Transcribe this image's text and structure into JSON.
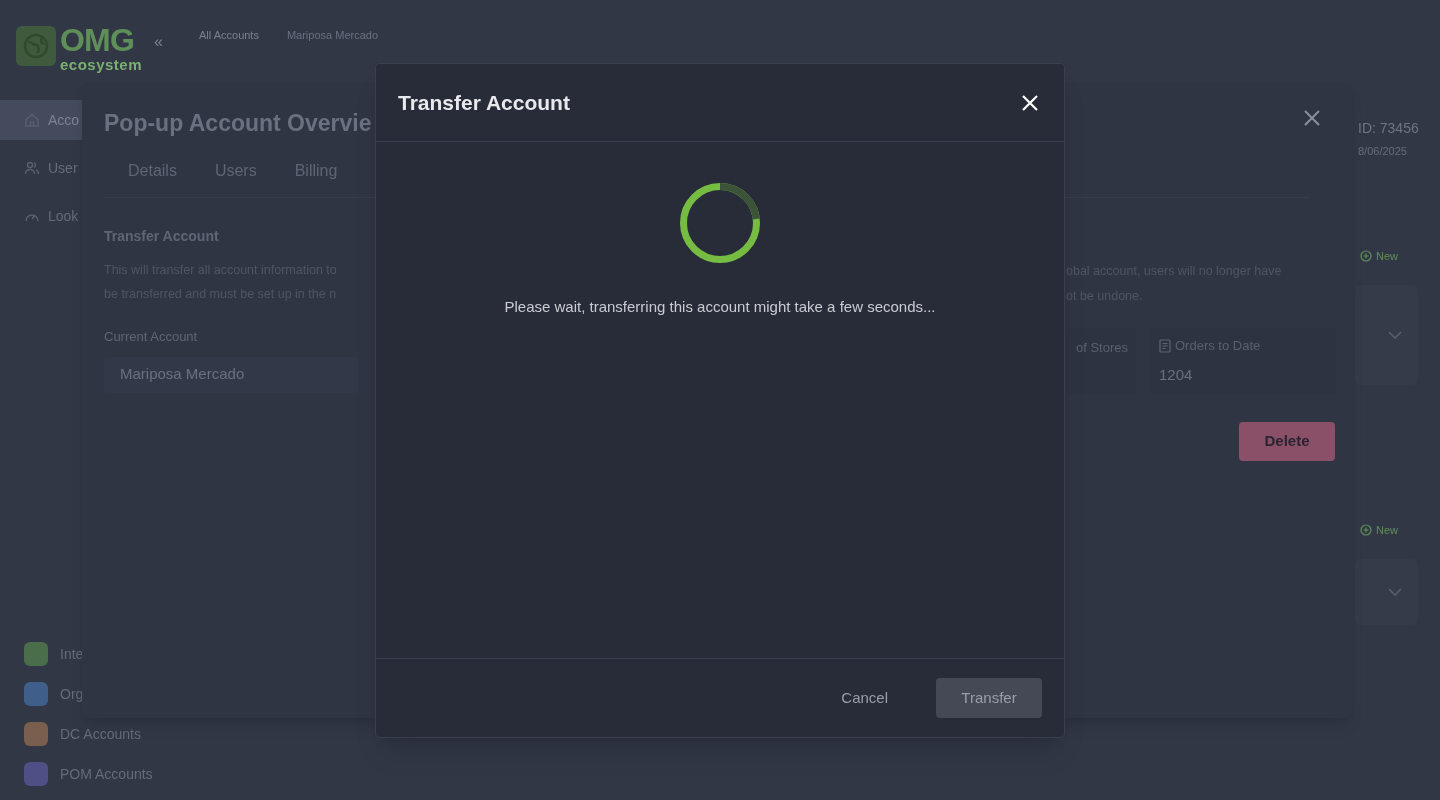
{
  "app": {
    "logo": {
      "title": "OMG",
      "subtitle": "ecosystem"
    },
    "collapse_icon": "«",
    "breadcrumbs": [
      "All Accounts",
      "Mariposa Mercado"
    ],
    "nav": [
      {
        "label": "Acco",
        "selected": true
      },
      {
        "label": "User",
        "selected": false
      },
      {
        "label": "Look",
        "selected": false
      }
    ],
    "apps": [
      {
        "label": "Inte",
        "color": "#4b6e4a"
      },
      {
        "label": "Org",
        "color": "#3f5f8a"
      },
      {
        "label": "DC Accounts",
        "color": "#7a5e4e"
      },
      {
        "label": "POM Accounts",
        "color": "#4f4f86"
      }
    ],
    "account_id": "ID: 73456",
    "date": "8/06/2025",
    "new_buttons": [
      "New",
      "New"
    ]
  },
  "account_popup": {
    "title": "Pop-up Account Overvie",
    "tabs": [
      {
        "label": "Details",
        "selected": false
      },
      {
        "label": "Users",
        "selected": false
      },
      {
        "label": "Billing",
        "selected": false
      }
    ],
    "section_title": "Transfer Account",
    "description_left": [
      "This will transfer all account information to",
      "be transferred and must be set up in the n"
    ],
    "description_right": [
      "obal account, users will no longer have",
      "ot be undone."
    ],
    "current_account_label": "Current Account",
    "current_account": "Mariposa Mercado",
    "stats": [
      {
        "label": "of Stores"
      },
      {
        "label": "Orders to Date",
        "value": "1204"
      }
    ],
    "delete_button": "Delete"
  },
  "modal": {
    "title": "Transfer Account",
    "message": "Please wait, transferring this account might take a few seconds...",
    "buttons": [
      {
        "label": "Cancel",
        "kind": "text",
        "disabled": false
      },
      {
        "label": "Transfer",
        "kind": "filled",
        "disabled": true
      }
    ]
  }
}
